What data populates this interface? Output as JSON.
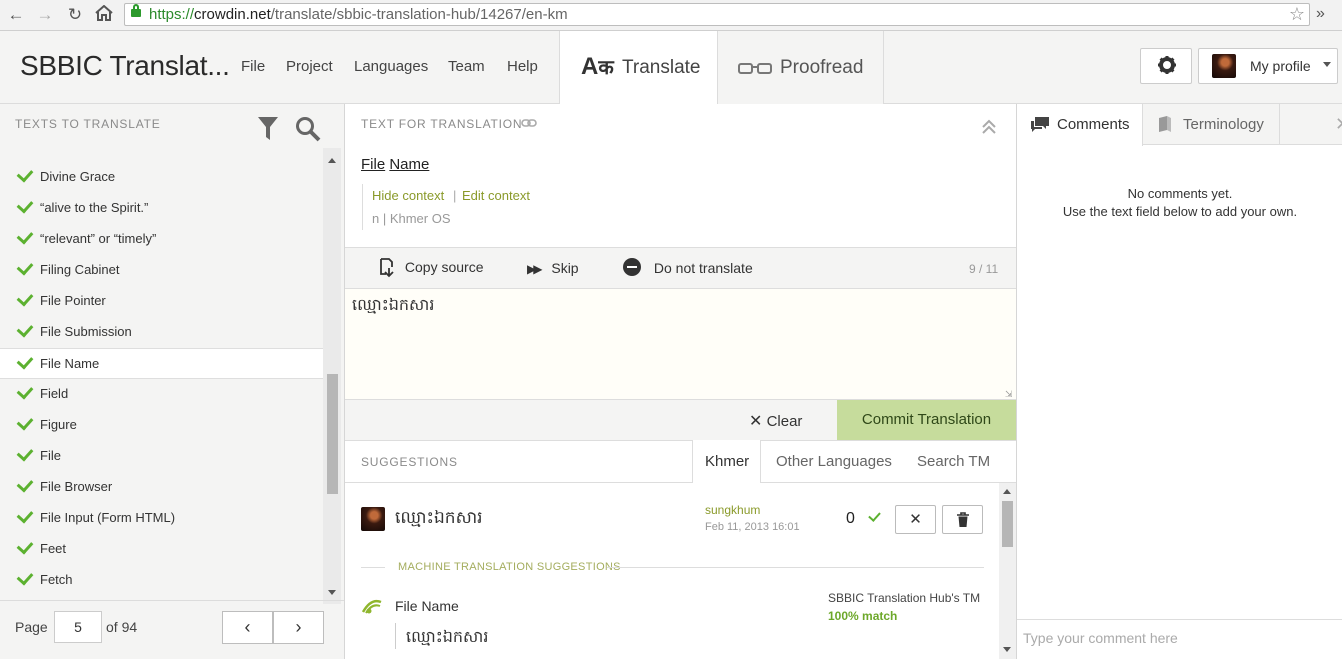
{
  "browser": {
    "url_scheme": "https://",
    "url_host": "crowdin.net",
    "url_path": "/translate/sbbic-translation-hub/14267/en-km"
  },
  "header": {
    "project_title": "SBBIC Translat...",
    "menu": [
      "File",
      "Project",
      "Languages",
      "Team",
      "Help"
    ],
    "tab_translate": "Translate",
    "tab_proofread": "Proofread",
    "profile_label": "My profile"
  },
  "left_panel": {
    "title": "TEXTS TO TRANSLATE",
    "items": [
      "Divine Grace",
      "“alive to the Spirit.”",
      "“relevant” or “timely”",
      "Filing Cabinet",
      "File Pointer",
      "File Submission",
      "File Name",
      "Field",
      "Figure",
      "File",
      "File Browser",
      "File Input (Form HTML)",
      "Feet",
      "Fetch"
    ],
    "active_item": "File Name",
    "pager": {
      "page_label": "Page",
      "current_page": "5",
      "total_label": "of 94"
    }
  },
  "center": {
    "title": "TEXT FOR TRANSLATION",
    "source_word1": "File",
    "source_word2": "Name",
    "hide_context": "Hide context",
    "separator": "|",
    "edit_context": "Edit context",
    "context_line": "n | Khmer OS",
    "toolbar": {
      "copy_source": "Copy source",
      "skip": "Skip",
      "do_not_translate": "Do not translate",
      "counter": "9 / 11"
    },
    "translation_text": "ឈ្មោះឯកសារ",
    "clear": "Clear",
    "commit": "Commit Translation",
    "suggestions": {
      "title": "SUGGESTIONS",
      "tabs": [
        "Khmer",
        "Other Languages",
        "Search TM"
      ],
      "active_tab": "Khmer",
      "user_suggestion": {
        "text": "ឈ្មោះឯកសារ",
        "author": "sungkhum",
        "date": "Feb 11, 2013 16:01",
        "votes": "0"
      },
      "mt_header": "MACHINE TRANSLATION SUGGESTIONS",
      "tm": {
        "source": "File Name",
        "translation": "ឈ្មោះឯកសារ",
        "origin": "SBBIC Translation Hub's TM",
        "match": "100% match"
      }
    }
  },
  "right_panel": {
    "tab_comments": "Comments",
    "tab_terminology": "Terminology",
    "empty_title": "No comments yet.",
    "empty_hint": "Use the text field below to add your own.",
    "comment_placeholder": "Type your comment here"
  },
  "colors": {
    "accent_green": "#5cb130",
    "commit_bg": "#c6dc9c",
    "link_olive": "#8a9a2a"
  }
}
